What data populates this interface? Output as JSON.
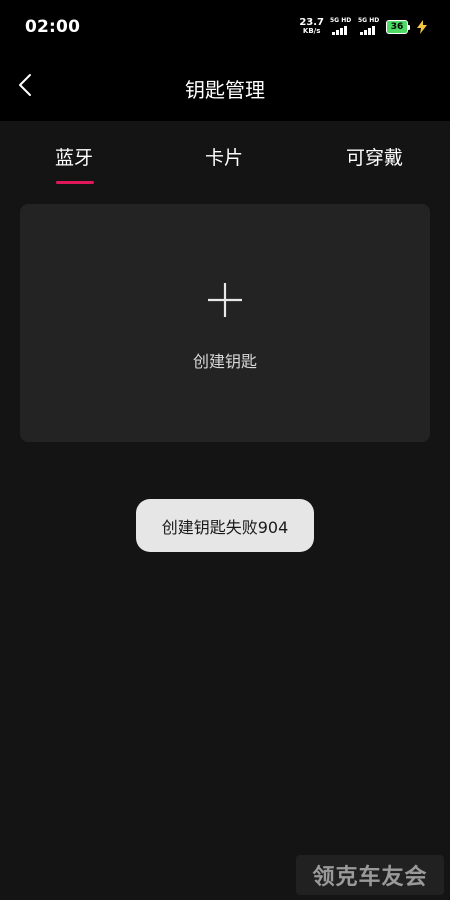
{
  "status_bar": {
    "time": "02:00",
    "net_speed_value": "23.7",
    "net_speed_unit": "KB/s",
    "signal_1_label": "5G HD",
    "signal_2_label": "5G HD",
    "battery_level": "36",
    "battery_color": "#4cd964",
    "charge_icon": "lightning-icon"
  },
  "header": {
    "back_icon": "chevron-left-icon",
    "title": "钥匙管理"
  },
  "tabs": [
    {
      "label": "蓝牙",
      "active": true
    },
    {
      "label": "卡片",
      "active": false
    },
    {
      "label": "可穿戴",
      "active": false
    }
  ],
  "accent_color": "#e0185a",
  "card": {
    "icon": "plus-icon",
    "label": "创建钥匙"
  },
  "toast": {
    "message": "创建钥匙失败904"
  },
  "watermark": {
    "text": "领克车友会"
  }
}
